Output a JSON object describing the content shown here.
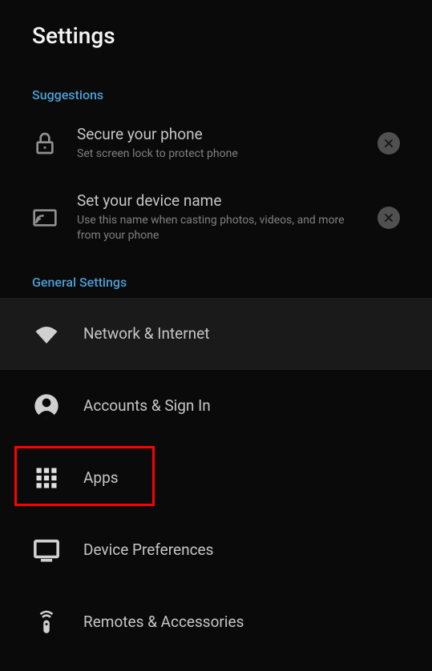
{
  "header": {
    "title": "Settings"
  },
  "sections": {
    "suggestions": {
      "header": "Suggestions",
      "items": [
        {
          "title": "Secure your phone",
          "subtitle": "Set screen lock to protect phone"
        },
        {
          "title": "Set your device name",
          "subtitle": "Use this name when casting photos, videos, and more from your phone"
        }
      ]
    },
    "general": {
      "header": "General Settings",
      "items": [
        {
          "label": "Network & Internet"
        },
        {
          "label": "Accounts & Sign In"
        },
        {
          "label": "Apps"
        },
        {
          "label": "Device Preferences"
        },
        {
          "label": "Remotes & Accessories"
        }
      ]
    }
  }
}
